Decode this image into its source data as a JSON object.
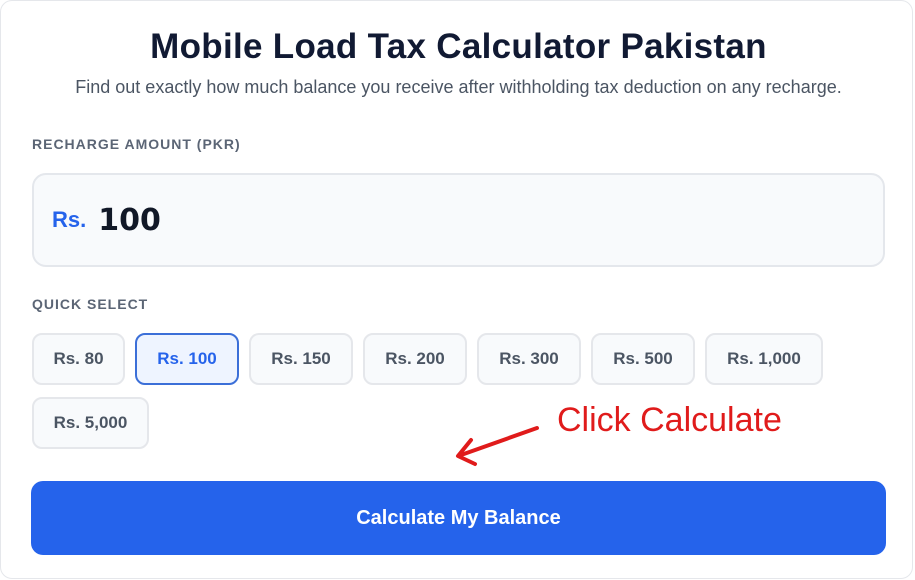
{
  "header": {
    "title": "Mobile Load Tax Calculator Pakistan",
    "subtitle": "Find out exactly how much balance you receive after withholding tax deduction on any recharge."
  },
  "recharge": {
    "label": "RECHARGE AMOUNT (PKR)",
    "prefix": "Rs.",
    "value": "100"
  },
  "quick_select": {
    "label": "QUICK SELECT",
    "options": [
      "Rs. 80",
      "Rs. 100",
      "Rs. 150",
      "Rs. 200",
      "Rs. 300",
      "Rs. 500",
      "Rs. 1,000",
      "Rs. 5,000"
    ],
    "selected": "Rs. 100"
  },
  "annotation": {
    "text": "Click Calculate",
    "color": "#e01b1b",
    "icon": "arrow-left-down-icon"
  },
  "actions": {
    "calculate_label": "Calculate My Balance"
  },
  "colors": {
    "accent": "#2563eb",
    "title": "#111a33"
  }
}
